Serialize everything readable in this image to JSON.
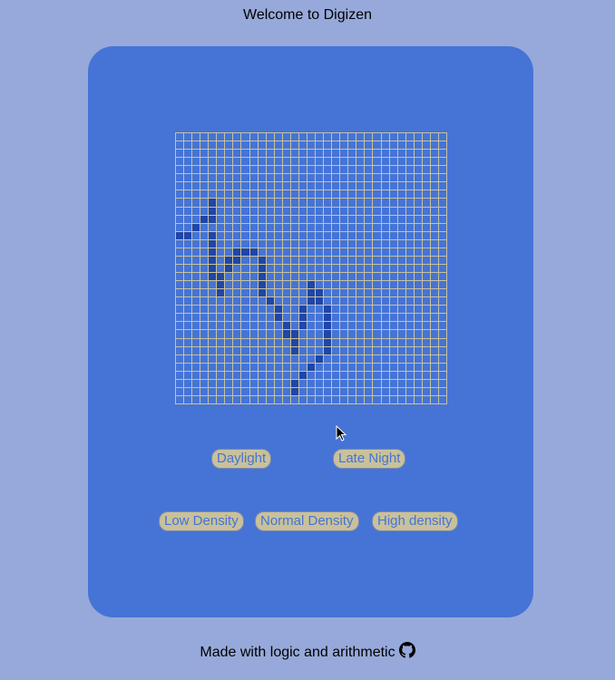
{
  "header": {
    "title": "Welcome to Digizen"
  },
  "board": {
    "rows": 33,
    "cols": 33,
    "alive_cells": [
      [
        8,
        4
      ],
      [
        9,
        4
      ],
      [
        10,
        3
      ],
      [
        10,
        4
      ],
      [
        11,
        2
      ],
      [
        12,
        0
      ],
      [
        12,
        1
      ],
      [
        12,
        4
      ],
      [
        13,
        4
      ],
      [
        14,
        4
      ],
      [
        14,
        7
      ],
      [
        14,
        8
      ],
      [
        14,
        9
      ],
      [
        15,
        4
      ],
      [
        15,
        6
      ],
      [
        15,
        7
      ],
      [
        15,
        10
      ],
      [
        16,
        4
      ],
      [
        16,
        6
      ],
      [
        16,
        10
      ],
      [
        17,
        4
      ],
      [
        17,
        5
      ],
      [
        17,
        10
      ],
      [
        18,
        5
      ],
      [
        18,
        10
      ],
      [
        18,
        16
      ],
      [
        19,
        5
      ],
      [
        19,
        10
      ],
      [
        19,
        16
      ],
      [
        19,
        17
      ],
      [
        20,
        11
      ],
      [
        20,
        16
      ],
      [
        20,
        17
      ],
      [
        21,
        12
      ],
      [
        21,
        15
      ],
      [
        21,
        18
      ],
      [
        22,
        12
      ],
      [
        22,
        15
      ],
      [
        22,
        18
      ],
      [
        23,
        13
      ],
      [
        23,
        15
      ],
      [
        23,
        18
      ],
      [
        24,
        13
      ],
      [
        24,
        14
      ],
      [
        24,
        18
      ],
      [
        25,
        14
      ],
      [
        25,
        18
      ],
      [
        26,
        14
      ],
      [
        26,
        18
      ],
      [
        27,
        17
      ],
      [
        28,
        16
      ],
      [
        29,
        15
      ],
      [
        30,
        14
      ],
      [
        31,
        14
      ]
    ]
  },
  "theme_buttons": {
    "daylight": "Daylight",
    "late_night": "Late Night"
  },
  "density_buttons": {
    "low": "Low Density",
    "normal": "Normal Density",
    "high": "High density"
  },
  "footer": {
    "text": "Made with logic and arithmetic"
  },
  "colors": {
    "page_bg": "#97a9da",
    "panel_bg": "#4574d6",
    "grid_line": "#c9c19a",
    "alive_cell": "#1f46a8",
    "button_bg": "#c9c19a",
    "button_text": "#4574d6"
  },
  "icons": {
    "footer_icon": "github-icon"
  }
}
